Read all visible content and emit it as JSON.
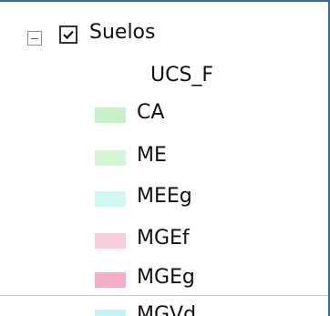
{
  "layer": {
    "name": "Suelos",
    "checked": true,
    "expanded": true
  },
  "field": {
    "name": "UCS_F"
  },
  "legend": [
    {
      "label": "CA",
      "color": "#c8f0c8"
    },
    {
      "label": "ME",
      "color": "#d2f7d2"
    },
    {
      "label": "MEEg",
      "color": "#cff7f4"
    },
    {
      "label": "MGEf",
      "color": "#f8cedb"
    },
    {
      "label": "MGEg",
      "color": "#f5aec6"
    },
    {
      "label": "MGVd",
      "color": "#c8f0f8"
    }
  ],
  "icons": {
    "expander": "collapse-minus-icon",
    "checkbox": "checkbox-checked-icon"
  }
}
